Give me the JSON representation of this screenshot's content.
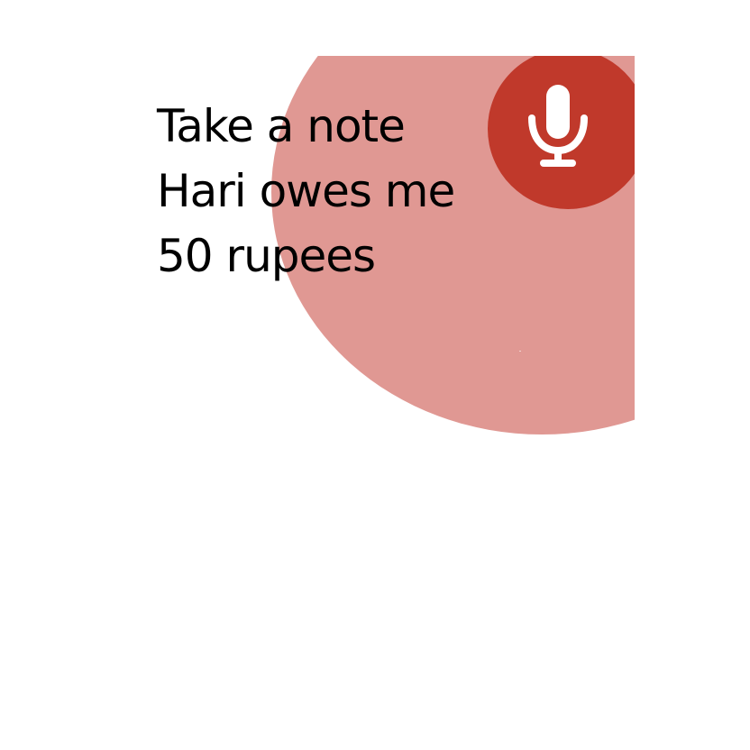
{
  "transcript": {
    "lines": [
      "Take a note",
      "Hari owes me",
      "50 rupees"
    ]
  },
  "mic_button": {
    "icon": "microphone-icon",
    "color": "#c0392b",
    "icon_color": "#ffffff"
  },
  "listening_ripple": {
    "color": "#e09893"
  },
  "background": "#ffffff"
}
